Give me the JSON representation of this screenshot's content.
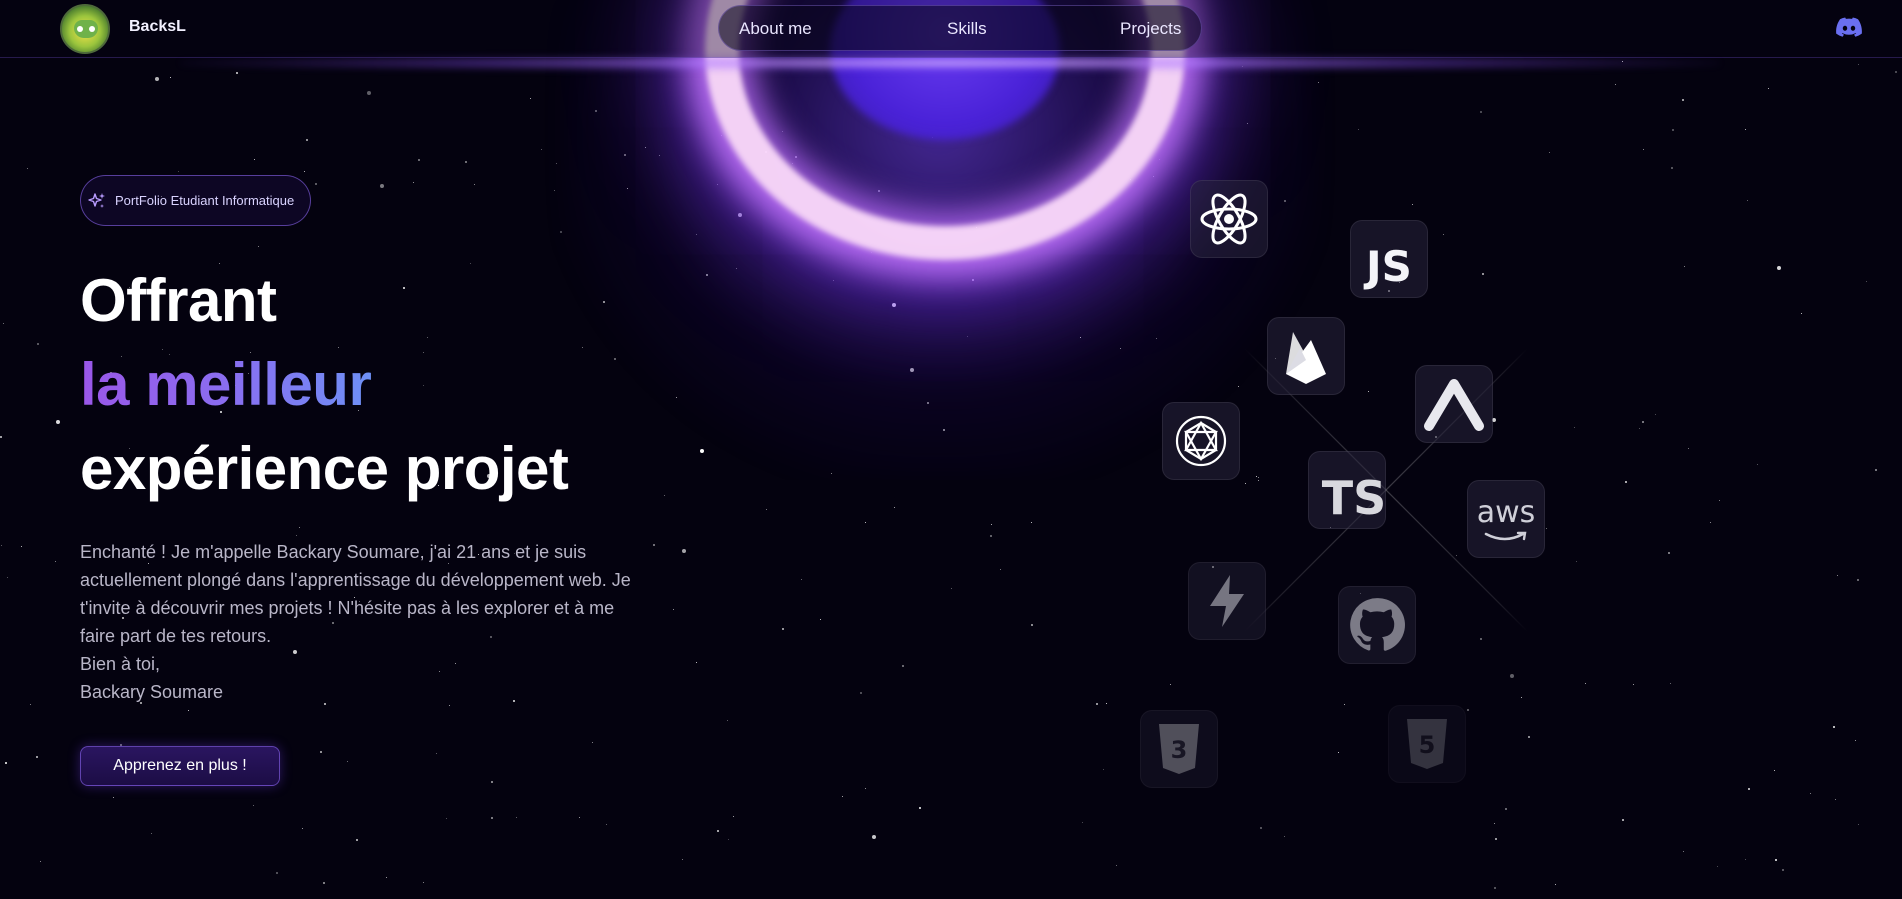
{
  "header": {
    "brand": "BacksL",
    "nav": [
      "About me",
      "Skills",
      "Projects"
    ],
    "discord_icon": "discord-icon"
  },
  "hero": {
    "badge": "PortFolio Etudiant Informatique",
    "title_line1": "Offrant",
    "title_line2": "la meilleur",
    "title_line3": "expérience projet",
    "description": [
      "Enchanté ! Je m'appelle Backary Soumare, j'ai 21 ans et je suis",
      "actuellement plongé dans l'apprentissage du développement web. Je",
      "t'invite à découvrir mes projets ! N'hésite pas à les explorer et à me",
      "faire part de tes retours.",
      "Bien à toi,",
      "Backary Soumare"
    ],
    "cta": "Apprenez en plus !"
  },
  "skills": {
    "js_label": "JS",
    "ts_label": "TS",
    "aws_label": "aws",
    "icons": [
      "react-icon",
      "javascript-icon",
      "firebase-icon",
      "expo-icon",
      "openai-icon",
      "typescript-icon",
      "aws-icon",
      "supabase-icon",
      "github-icon",
      "css3-icon",
      "html5-icon"
    ]
  },
  "colors": {
    "background": "#04020f",
    "accent": "#7c4dff",
    "gradient_start": "#9a57e8",
    "gradient_end": "#6e90f5"
  }
}
